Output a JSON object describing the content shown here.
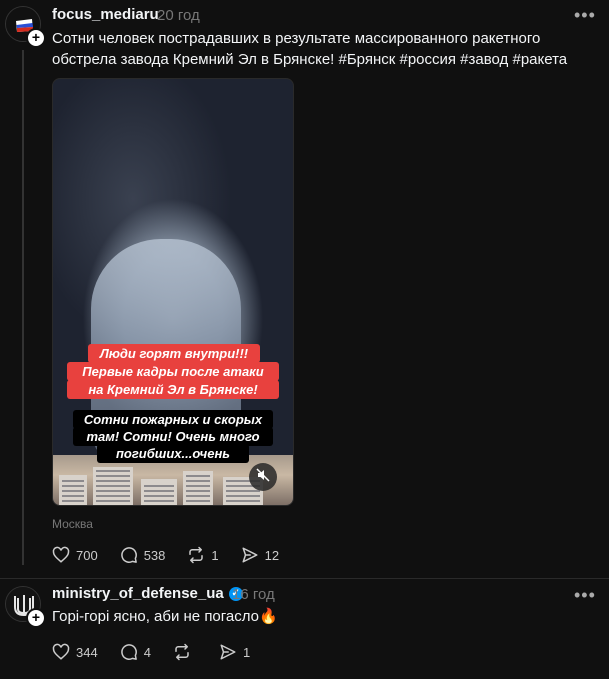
{
  "post1": {
    "username": "focus_mediaru",
    "time": "20 год",
    "text_line1": "Сотни человек пострадавших в результате массированного ракетного",
    "text_line2": "обстрела завода Кремний Эл в Брянске! #Брянск #россия #завод #ракета",
    "captions": {
      "red1": "Люди горят внутри!!!",
      "red2": "Первые кадры после атаки",
      "red3": "на Кремний Эл в Брянске!",
      "black1": "Сотни пожарных и скорых",
      "black2": "там! Сотни! Очень много",
      "black3": "погибших...очень"
    },
    "location": "Москва",
    "likes": "700",
    "comments": "538",
    "reposts": "1",
    "shares": "12"
  },
  "post2": {
    "username": "ministry_of_defense_ua",
    "time": "16 год",
    "text": "Горі-горі ясно, аби не погасло🔥",
    "likes": "344",
    "comments": "4",
    "shares": "1"
  },
  "icons": {
    "more": "more-icon",
    "like": "heart-icon",
    "comment": "comment-icon",
    "repost": "repost-icon",
    "share": "send-icon",
    "mute": "mute-icon",
    "verified": "verified-badge-icon"
  },
  "colors": {
    "background": "#101010",
    "caption_red": "#e8413e",
    "verified": "#0095f6"
  }
}
